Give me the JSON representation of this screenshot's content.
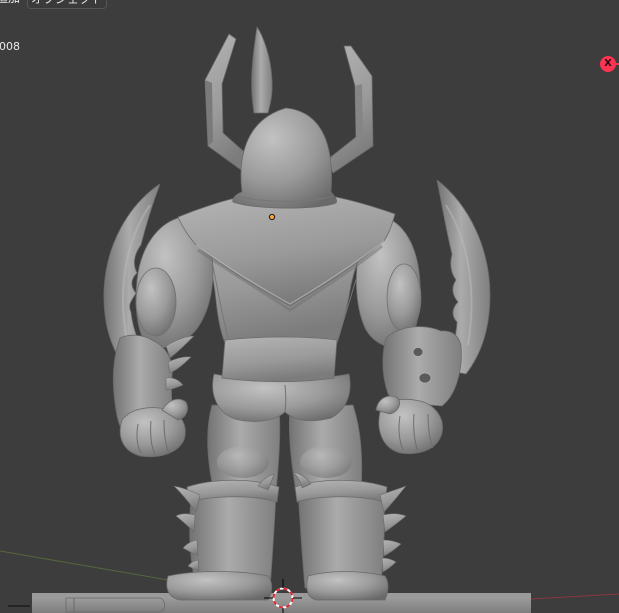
{
  "header": {
    "menus": [
      {
        "label": "追加"
      },
      {
        "label": "オブジェクト"
      }
    ]
  },
  "viewport": {
    "object_info_text": "008",
    "background_color": "#3d3d3d",
    "model_color": "#9a9a9a"
  },
  "navigation_gizmo": {
    "x_axis": {
      "label": "X",
      "color": "#ff3352"
    }
  },
  "scene_axes": {
    "x_axis_color": "#a8383f",
    "y_axis_color": "#6a8a3c"
  },
  "icons": {
    "cursor": "3d-cursor-icon",
    "origin": "object-origin-icon"
  }
}
